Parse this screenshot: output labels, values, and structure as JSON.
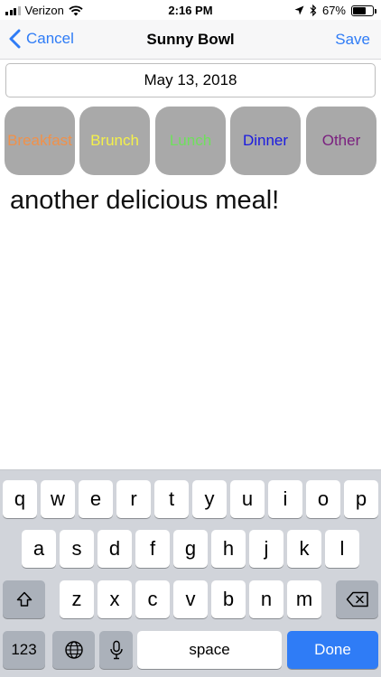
{
  "status_bar": {
    "carrier": "Verizon",
    "time": "2:16 PM",
    "battery": "67%",
    "battery_level": 0.67,
    "icons": [
      "signal-icon",
      "wifi-icon",
      "location-arrow-icon",
      "bluetooth-icon",
      "battery-icon"
    ]
  },
  "nav": {
    "back_label": "Cancel",
    "title": "Sunny Bowl",
    "save_label": "Save"
  },
  "date": "May 13, 2018",
  "meals": [
    {
      "label": "Breakfast",
      "color": "#f0914a"
    },
    {
      "label": "Brunch",
      "color": "#f4f04a"
    },
    {
      "label": "Lunch",
      "color": "#6fe05c"
    },
    {
      "label": "Dinner",
      "color": "#1a1ae0"
    },
    {
      "label": "Other",
      "color": "#7a1f7f"
    }
  ],
  "note": "another delicious meal!",
  "keyboard": {
    "row1": [
      "q",
      "w",
      "e",
      "r",
      "t",
      "y",
      "u",
      "i",
      "o",
      "p"
    ],
    "row2": [
      "a",
      "s",
      "d",
      "f",
      "g",
      "h",
      "j",
      "k",
      "l"
    ],
    "row3": [
      "z",
      "x",
      "c",
      "v",
      "b",
      "n",
      "m"
    ],
    "numbers_label": "123",
    "space_label": "space",
    "done_label": "Done",
    "colors": {
      "background": "#d1d4da",
      "key": "#ffffff",
      "special_key": "#abb1ba",
      "done": "#2f7cf6"
    }
  }
}
